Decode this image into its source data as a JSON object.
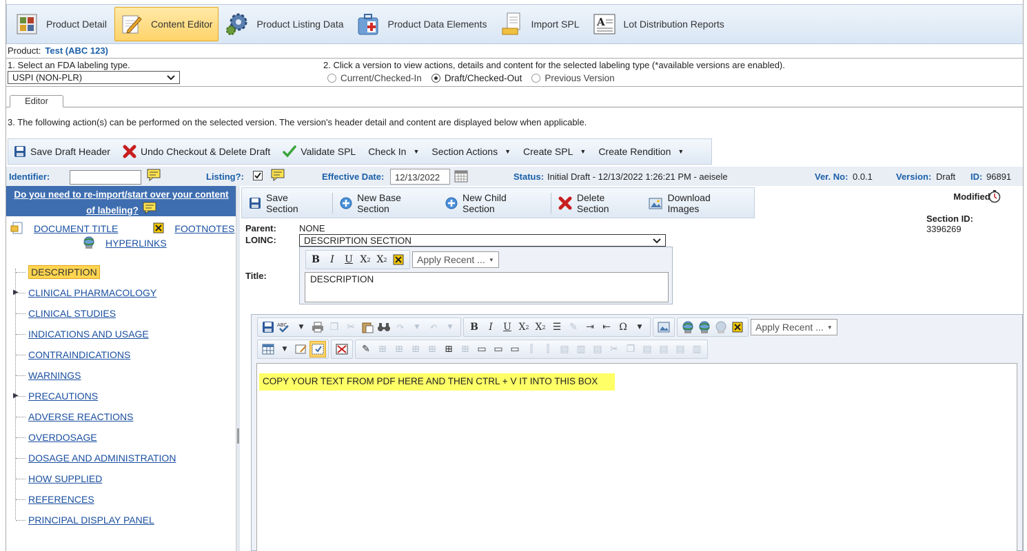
{
  "nav": {
    "items": [
      {
        "label": "Product Detail",
        "icon": "grid-icon"
      },
      {
        "label": "Content Editor",
        "icon": "pencil-icon",
        "active": true
      },
      {
        "label": "Product Listing Data",
        "icon": "gears-icon"
      },
      {
        "label": "Product Data Elements",
        "icon": "medkit-icon"
      },
      {
        "label": "Import SPL",
        "icon": "document-import-icon"
      },
      {
        "label": "Lot Distribution Reports",
        "icon": "text-document-icon"
      }
    ]
  },
  "product": {
    "label": "Product:",
    "value": "Test (ABC 123)"
  },
  "step1": {
    "label": "1. Select an FDA labeling type.",
    "selected": "USPI (NON-PLR)"
  },
  "step2": {
    "label": "2. Click a version to view actions, details and content for the selected labeling type (*available versions are enabled).",
    "options": [
      "Current/Checked-In",
      "Draft/Checked-Out",
      "Previous Version"
    ],
    "selected": "Draft/Checked-Out"
  },
  "tabs": {
    "editor": "Editor"
  },
  "step3": {
    "label": "3. The following action(s) can be performed on the selected version. The version's header detail and content are displayed below when applicable."
  },
  "actions": {
    "save_draft": "Save Draft Header",
    "undo_checkout": "Undo Checkout & Delete Draft",
    "validate": "Validate SPL",
    "check_in": "Check In",
    "section_actions": "Section Actions",
    "create_spl": "Create SPL",
    "create_rendition": "Create Rendition"
  },
  "meta": {
    "identifier_label": "Identifier:",
    "listing_label": "Listing?:",
    "effective_label": "Effective Date:",
    "effective_value": "12/13/2022",
    "status_label": "Status:",
    "status_value": "Initial Draft - 12/13/2022 1:26:21 PM - aeisele",
    "verno_label": "Ver. No:",
    "verno_value": "0.0.1",
    "version_label": "Version:",
    "version_value": "Draft",
    "id_label": "ID:",
    "id_value": "96891"
  },
  "left": {
    "reimport_line1": "Do you need to re-import/start over your content",
    "reimport_line2": "of labeling?",
    "document_title": "DOCUMENT TITLE",
    "footnotes": "FOOTNOTES",
    "hyperlinks": "HYPERLINKS",
    "tree": [
      {
        "label": "DESCRIPTION",
        "selected": true
      },
      {
        "label": "CLINICAL PHARMACOLOGY",
        "expandable": true
      },
      {
        "label": "CLINICAL STUDIES"
      },
      {
        "label": "INDICATIONS AND USAGE"
      },
      {
        "label": "CONTRAINDICATIONS"
      },
      {
        "label": "WARNINGS"
      },
      {
        "label": "PRECAUTIONS",
        "expandable": true
      },
      {
        "label": "ADVERSE REACTIONS"
      },
      {
        "label": "OVERDOSAGE"
      },
      {
        "label": "DOSAGE AND ADMINISTRATION"
      },
      {
        "label": "HOW SUPPLIED"
      },
      {
        "label": "REFERENCES"
      },
      {
        "label": "PRINCIPAL DISPLAY PANEL"
      }
    ]
  },
  "section": {
    "save": "Save Section",
    "new_base": "New Base Section",
    "new_child": "New Child Section",
    "delete": "Delete Section",
    "download_images": "Download Images",
    "modified_label": "Modified:",
    "section_id_label": "Section ID:",
    "section_id_value": "3396269",
    "parent_label": "Parent:",
    "parent_value": "NONE",
    "loinc_label": "LOINC:",
    "loinc_value": "DESCRIPTION SECTION",
    "title_label": "Title:",
    "title_value": "DESCRIPTION",
    "apply_recent": "Apply Recent ..."
  },
  "editor": {
    "apply_recent": "Apply Recent ...",
    "content": "COPY YOUR TEXT FROM PDF HERE AND THEN CTRL + V IT INTO THIS BOX"
  }
}
